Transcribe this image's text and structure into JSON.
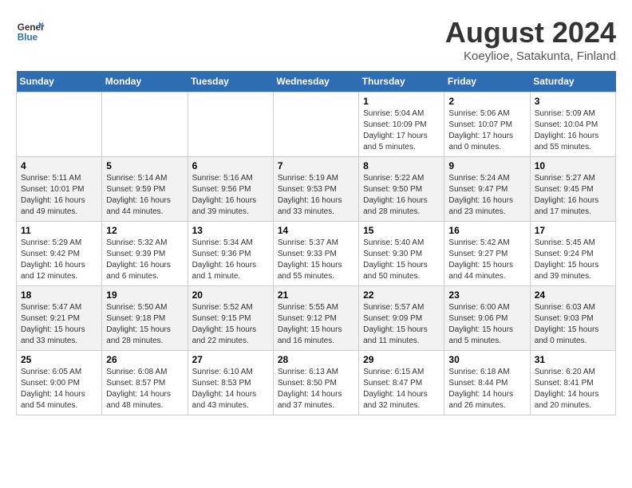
{
  "header": {
    "logo_line1": "General",
    "logo_line2": "Blue",
    "title": "August 2024",
    "subtitle": "Koeylioe, Satakunta, Finland"
  },
  "weekdays": [
    "Sunday",
    "Monday",
    "Tuesday",
    "Wednesday",
    "Thursday",
    "Friday",
    "Saturday"
  ],
  "weeks": [
    [
      {
        "day": "",
        "sunrise": "",
        "sunset": "",
        "daylight": ""
      },
      {
        "day": "",
        "sunrise": "",
        "sunset": "",
        "daylight": ""
      },
      {
        "day": "",
        "sunrise": "",
        "sunset": "",
        "daylight": ""
      },
      {
        "day": "",
        "sunrise": "",
        "sunset": "",
        "daylight": ""
      },
      {
        "day": "1",
        "sunrise": "Sunrise: 5:04 AM",
        "sunset": "Sunset: 10:09 PM",
        "daylight": "Daylight: 17 hours and 5 minutes."
      },
      {
        "day": "2",
        "sunrise": "Sunrise: 5:06 AM",
        "sunset": "Sunset: 10:07 PM",
        "daylight": "Daylight: 17 hours and 0 minutes."
      },
      {
        "day": "3",
        "sunrise": "Sunrise: 5:09 AM",
        "sunset": "Sunset: 10:04 PM",
        "daylight": "Daylight: 16 hours and 55 minutes."
      }
    ],
    [
      {
        "day": "4",
        "sunrise": "Sunrise: 5:11 AM",
        "sunset": "Sunset: 10:01 PM",
        "daylight": "Daylight: 16 hours and 49 minutes."
      },
      {
        "day": "5",
        "sunrise": "Sunrise: 5:14 AM",
        "sunset": "Sunset: 9:59 PM",
        "daylight": "Daylight: 16 hours and 44 minutes."
      },
      {
        "day": "6",
        "sunrise": "Sunrise: 5:16 AM",
        "sunset": "Sunset: 9:56 PM",
        "daylight": "Daylight: 16 hours and 39 minutes."
      },
      {
        "day": "7",
        "sunrise": "Sunrise: 5:19 AM",
        "sunset": "Sunset: 9:53 PM",
        "daylight": "Daylight: 16 hours and 33 minutes."
      },
      {
        "day": "8",
        "sunrise": "Sunrise: 5:22 AM",
        "sunset": "Sunset: 9:50 PM",
        "daylight": "Daylight: 16 hours and 28 minutes."
      },
      {
        "day": "9",
        "sunrise": "Sunrise: 5:24 AM",
        "sunset": "Sunset: 9:47 PM",
        "daylight": "Daylight: 16 hours and 23 minutes."
      },
      {
        "day": "10",
        "sunrise": "Sunrise: 5:27 AM",
        "sunset": "Sunset: 9:45 PM",
        "daylight": "Daylight: 16 hours and 17 minutes."
      }
    ],
    [
      {
        "day": "11",
        "sunrise": "Sunrise: 5:29 AM",
        "sunset": "Sunset: 9:42 PM",
        "daylight": "Daylight: 16 hours and 12 minutes."
      },
      {
        "day": "12",
        "sunrise": "Sunrise: 5:32 AM",
        "sunset": "Sunset: 9:39 PM",
        "daylight": "Daylight: 16 hours and 6 minutes."
      },
      {
        "day": "13",
        "sunrise": "Sunrise: 5:34 AM",
        "sunset": "Sunset: 9:36 PM",
        "daylight": "Daylight: 16 hours and 1 minute."
      },
      {
        "day": "14",
        "sunrise": "Sunrise: 5:37 AM",
        "sunset": "Sunset: 9:33 PM",
        "daylight": "Daylight: 15 hours and 55 minutes."
      },
      {
        "day": "15",
        "sunrise": "Sunrise: 5:40 AM",
        "sunset": "Sunset: 9:30 PM",
        "daylight": "Daylight: 15 hours and 50 minutes."
      },
      {
        "day": "16",
        "sunrise": "Sunrise: 5:42 AM",
        "sunset": "Sunset: 9:27 PM",
        "daylight": "Daylight: 15 hours and 44 minutes."
      },
      {
        "day": "17",
        "sunrise": "Sunrise: 5:45 AM",
        "sunset": "Sunset: 9:24 PM",
        "daylight": "Daylight: 15 hours and 39 minutes."
      }
    ],
    [
      {
        "day": "18",
        "sunrise": "Sunrise: 5:47 AM",
        "sunset": "Sunset: 9:21 PM",
        "daylight": "Daylight: 15 hours and 33 minutes."
      },
      {
        "day": "19",
        "sunrise": "Sunrise: 5:50 AM",
        "sunset": "Sunset: 9:18 PM",
        "daylight": "Daylight: 15 hours and 28 minutes."
      },
      {
        "day": "20",
        "sunrise": "Sunrise: 5:52 AM",
        "sunset": "Sunset: 9:15 PM",
        "daylight": "Daylight: 15 hours and 22 minutes."
      },
      {
        "day": "21",
        "sunrise": "Sunrise: 5:55 AM",
        "sunset": "Sunset: 9:12 PM",
        "daylight": "Daylight: 15 hours and 16 minutes."
      },
      {
        "day": "22",
        "sunrise": "Sunrise: 5:57 AM",
        "sunset": "Sunset: 9:09 PM",
        "daylight": "Daylight: 15 hours and 11 minutes."
      },
      {
        "day": "23",
        "sunrise": "Sunrise: 6:00 AM",
        "sunset": "Sunset: 9:06 PM",
        "daylight": "Daylight: 15 hours and 5 minutes."
      },
      {
        "day": "24",
        "sunrise": "Sunrise: 6:03 AM",
        "sunset": "Sunset: 9:03 PM",
        "daylight": "Daylight: 15 hours and 0 minutes."
      }
    ],
    [
      {
        "day": "25",
        "sunrise": "Sunrise: 6:05 AM",
        "sunset": "Sunset: 9:00 PM",
        "daylight": "Daylight: 14 hours and 54 minutes."
      },
      {
        "day": "26",
        "sunrise": "Sunrise: 6:08 AM",
        "sunset": "Sunset: 8:57 PM",
        "daylight": "Daylight: 14 hours and 48 minutes."
      },
      {
        "day": "27",
        "sunrise": "Sunrise: 6:10 AM",
        "sunset": "Sunset: 8:53 PM",
        "daylight": "Daylight: 14 hours and 43 minutes."
      },
      {
        "day": "28",
        "sunrise": "Sunrise: 6:13 AM",
        "sunset": "Sunset: 8:50 PM",
        "daylight": "Daylight: 14 hours and 37 minutes."
      },
      {
        "day": "29",
        "sunrise": "Sunrise: 6:15 AM",
        "sunset": "Sunset: 8:47 PM",
        "daylight": "Daylight: 14 hours and 32 minutes."
      },
      {
        "day": "30",
        "sunrise": "Sunrise: 6:18 AM",
        "sunset": "Sunset: 8:44 PM",
        "daylight": "Daylight: 14 hours and 26 minutes."
      },
      {
        "day": "31",
        "sunrise": "Sunrise: 6:20 AM",
        "sunset": "Sunset: 8:41 PM",
        "daylight": "Daylight: 14 hours and 20 minutes."
      }
    ]
  ]
}
